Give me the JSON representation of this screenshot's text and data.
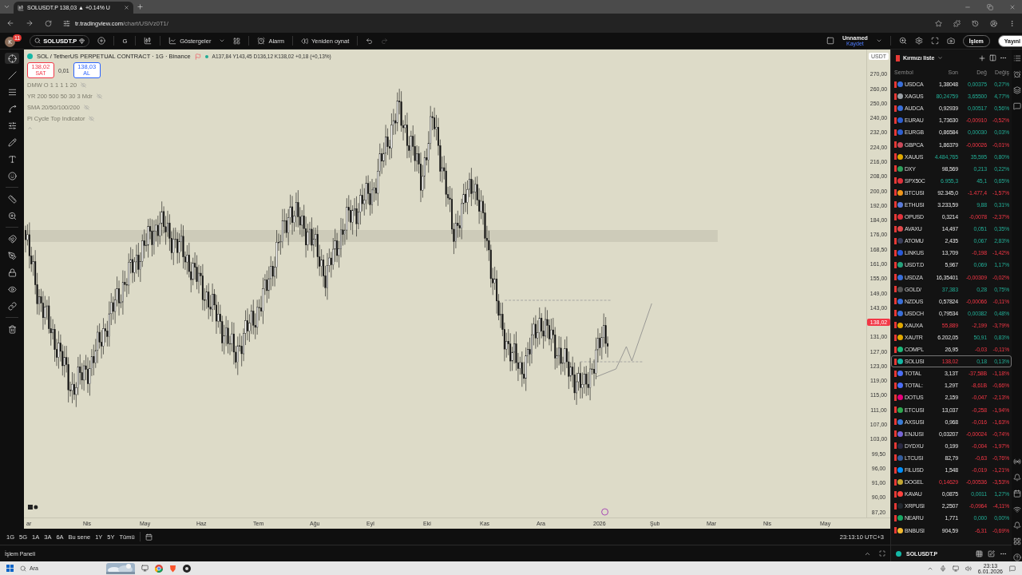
{
  "browser": {
    "tab": {
      "title": "SOLUSDT.P 138,03 ▲ +0.14% U"
    },
    "url": {
      "host": "tr.tradingview.com",
      "path": "/chart/USiVz0T1/"
    }
  },
  "toolbar": {
    "avatar": "K",
    "notifications": "11",
    "symbol": "SOLUSDT.P",
    "interval": "G",
    "indicators": "Göstergeler",
    "alarm": "Alarm",
    "replay": "Yeniden oynat",
    "layout": {
      "name": "Unnamed",
      "save": "Kaydet"
    },
    "trade": "İşlem",
    "publish": "Yayınl"
  },
  "chart": {
    "legend": {
      "title": "SOL / TetherUS PERPETUAL CONTRACT · 1G · Binance",
      "ohlc": "A137,84 Y143,45 D136,12 K138,02 +0,18 (+0,13%)"
    },
    "sell": {
      "price": "138,02",
      "label": "SAT"
    },
    "spread": "0,01",
    "buy": {
      "price": "138,03",
      "label": "AL"
    },
    "indicators": [
      {
        "name": "DMW O 1 1 1 1 20",
        "visible": false
      },
      {
        "name": "YR 200 500 50 30 3 Mdr",
        "visible": false
      },
      {
        "name": "SMA 20/50/100/200",
        "visible": false
      },
      {
        "name": "Pi Cycle Top Indicator",
        "visible": false
      }
    ],
    "currency": "USDT",
    "price_axis": [
      {
        "label": "270,00",
        "kind": "tick"
      },
      {
        "label": "260,00",
        "kind": "tick"
      },
      {
        "label": "250,00",
        "kind": "tick"
      },
      {
        "label": "240,00",
        "kind": "tick"
      },
      {
        "label": "232,00",
        "kind": "tick"
      },
      {
        "label": "224,00",
        "kind": "tick"
      },
      {
        "label": "216,00",
        "kind": "tick"
      },
      {
        "label": "208,00",
        "kind": "tick"
      },
      {
        "label": "200,00",
        "kind": "tick"
      },
      {
        "label": "192,00",
        "kind": "tick"
      },
      {
        "label": "184,00",
        "kind": "tick"
      },
      {
        "label": "176,00",
        "kind": "tick"
      },
      {
        "label": "168,50",
        "kind": "tick"
      },
      {
        "label": "161,00",
        "kind": "tick"
      },
      {
        "label": "155,00",
        "kind": "tick"
      },
      {
        "label": "149,00",
        "kind": "tick"
      },
      {
        "label": "143,00",
        "kind": "tick"
      },
      {
        "label": "138,02",
        "kind": "current"
      },
      {
        "label": "131,00",
        "kind": "tick"
      },
      {
        "label": "127,00",
        "kind": "tick"
      },
      {
        "label": "123,00",
        "kind": "tick"
      },
      {
        "label": "119,00",
        "kind": "tick"
      },
      {
        "label": "115,00",
        "kind": "tick"
      },
      {
        "label": "111,00",
        "kind": "tick"
      },
      {
        "label": "107,00",
        "kind": "tick"
      },
      {
        "label": "103,00",
        "kind": "tick"
      },
      {
        "label": "99,50",
        "kind": "tick"
      },
      {
        "label": "96,00",
        "kind": "tick"
      },
      {
        "label": "91,00",
        "kind": "tick"
      },
      {
        "label": "90,00",
        "kind": "tick"
      },
      {
        "label": "87,20",
        "kind": "tick"
      }
    ],
    "time_axis": [
      "ar",
      "Nis",
      "May",
      "Haz",
      "Tem",
      "Ağu",
      "Eyl",
      "Eki",
      "Kas",
      "Ara",
      "2026",
      "Şub",
      "Mar",
      "Nis",
      "May"
    ]
  },
  "range_bar": {
    "ranges": [
      "1G",
      "5G",
      "1A",
      "3A",
      "6A",
      "Bu sene",
      "1Y",
      "5Y",
      "Tümü"
    ],
    "clock": "23:13:10 UTC+3"
  },
  "bottom_panel": {
    "title": "İşlem Paneli"
  },
  "watchlist": {
    "title": "Kırmızı liste",
    "columns": [
      "Sembol",
      "Son",
      "Değ",
      "Değiş"
    ],
    "rows": [
      {
        "symbol": "USDCA",
        "last": "1,38048",
        "change": "0,00375",
        "change_pct": "0,27%",
        "change_up": true,
        "last_up": false,
        "last_down": false,
        "color": "#3a6fd8",
        "selected": false
      },
      {
        "symbol": "XAGUS",
        "last": "80,24759",
        "change": "3,65500",
        "change_pct": "4,77%",
        "change_up": true,
        "last_up": true,
        "last_down": false,
        "color": "#9aa0a6",
        "selected": false
      },
      {
        "symbol": "AUDCA",
        "last": "0,92939",
        "change": "0,00517",
        "change_pct": "0,56%",
        "change_up": true,
        "last_up": false,
        "last_down": false,
        "color": "#3a6fd8",
        "selected": false
      },
      {
        "symbol": "EURAU",
        "last": "1,73630",
        "change": "-0,00910",
        "change_pct": "-0,52%",
        "change_up": false,
        "last_up": false,
        "last_down": false,
        "color": "#2f5fd0",
        "selected": false
      },
      {
        "symbol": "EURGB",
        "last": "0,86584",
        "change": "0,00030",
        "change_pct": "0,03%",
        "change_up": true,
        "last_up": false,
        "last_down": false,
        "color": "#2f5fd0",
        "selected": false
      },
      {
        "symbol": "GBPCA",
        "last": "1,86379",
        "change": "-0,00026",
        "change_pct": "-0,01%",
        "change_up": false,
        "last_up": false,
        "last_down": false,
        "color": "#c94a5a",
        "selected": false
      },
      {
        "symbol": "XAUUS",
        "last": "4.484,765",
        "change": "35,595",
        "change_pct": "0,80%",
        "change_up": true,
        "last_up": true,
        "last_down": false,
        "color": "#e0a800",
        "selected": false
      },
      {
        "symbol": "DXY",
        "last": "98,569",
        "change": "0,213",
        "change_pct": "0,22%",
        "change_up": true,
        "last_up": false,
        "last_down": false,
        "color": "#2e9e5b",
        "selected": false
      },
      {
        "symbol": "SPX50C",
        "last": "6.955,3",
        "change": "45,1",
        "change_pct": "0,65%",
        "change_up": true,
        "last_up": true,
        "last_down": false,
        "color": "#e0323c",
        "selected": false
      },
      {
        "symbol": "BTCUSI",
        "last": "92.345,0",
        "change": "-1.477,4",
        "change_pct": "-1,57%",
        "change_up": false,
        "last_up": false,
        "last_down": false,
        "color": "#f0961a",
        "selected": false
      },
      {
        "symbol": "ETHUSI",
        "last": "3.233,59",
        "change": "9,88",
        "change_pct": "0,31%",
        "change_up": true,
        "last_up": false,
        "last_down": false,
        "color": "#5b7bd8",
        "selected": false
      },
      {
        "symbol": "OPUSD",
        "last": "0,3214",
        "change": "-0,0078",
        "change_pct": "-2,37%",
        "change_up": false,
        "last_up": false,
        "last_down": false,
        "color": "#e0323c",
        "selected": false
      },
      {
        "symbol": "AVAXU",
        "last": "14,497",
        "change": "0,051",
        "change_pct": "0,35%",
        "change_up": true,
        "last_up": false,
        "last_down": false,
        "color": "#e0484a",
        "selected": false
      },
      {
        "symbol": "ATOMU",
        "last": "2,435",
        "change": "0,067",
        "change_pct": "2,83%",
        "change_up": true,
        "last_up": false,
        "last_down": false,
        "color": "#3b3f5c",
        "selected": false
      },
      {
        "symbol": "LINKUS",
        "last": "13,709",
        "change": "-0,198",
        "change_pct": "-1,42%",
        "change_up": false,
        "last_up": false,
        "last_down": false,
        "color": "#2a5ada",
        "selected": false
      },
      {
        "symbol": "USDT.D",
        "last": "5,967",
        "change": "0,069",
        "change_pct": "1,17%",
        "change_up": true,
        "last_up": false,
        "last_down": false,
        "color": "#26a17b",
        "selected": false
      },
      {
        "symbol": "USDZA",
        "last": "16,35401",
        "change": "-0,00309",
        "change_pct": "-0,02%",
        "change_up": false,
        "last_up": false,
        "last_down": false,
        "color": "#3a6fd8",
        "selected": false
      },
      {
        "symbol": "GOLD/",
        "last": "37,383",
        "change": "0,28",
        "change_pct": "0,75%",
        "change_up": true,
        "last_up": true,
        "last_down": false,
        "color": "#555555",
        "selected": false
      },
      {
        "symbol": "NZDUS",
        "last": "0,57824",
        "change": "-0,00066",
        "change_pct": "-0,11%",
        "change_up": false,
        "last_up": false,
        "last_down": false,
        "color": "#3a6fd8",
        "selected": false
      },
      {
        "symbol": "USDCH",
        "last": "0,79534",
        "change": "0,00382",
        "change_pct": "0,48%",
        "change_up": true,
        "last_up": false,
        "last_down": false,
        "color": "#3a6fd8",
        "selected": false
      },
      {
        "symbol": "XAUXA",
        "last": "55,889",
        "change": "-2,199",
        "change_pct": "-3,79%",
        "change_up": false,
        "last_up": false,
        "last_down": true,
        "color": "#e0a800",
        "selected": false
      },
      {
        "symbol": "XAUTR",
        "last": "6.202,05",
        "change": "50,91",
        "change_pct": "0,83%",
        "change_up": true,
        "last_up": false,
        "last_down": false,
        "color": "#e0a800",
        "selected": false
      },
      {
        "symbol": "COMPL",
        "last": "26,95",
        "change": "-0,03",
        "change_pct": "-0,11%",
        "change_up": false,
        "last_up": false,
        "last_down": false,
        "color": "#1db87a",
        "selected": false
      },
      {
        "symbol": "SOLUSI",
        "last": "138,02",
        "change": "0,18",
        "change_pct": "0,13%",
        "change_up": true,
        "last_up": false,
        "last_down": true,
        "color": "#14b8a6",
        "selected": true
      },
      {
        "symbol": "TOTAL",
        "last": "3,13T",
        "change": "-37,58B",
        "change_pct": "-1,18%",
        "change_up": false,
        "last_up": false,
        "last_down": false,
        "color": "#4c6ef5",
        "selected": false
      },
      {
        "symbol": "TOTAL:",
        "last": "1,29T",
        "change": "-8,61B",
        "change_pct": "-0,66%",
        "change_up": false,
        "last_up": false,
        "last_down": false,
        "color": "#4c6ef5",
        "selected": false
      },
      {
        "symbol": "DOTUS",
        "last": "2,159",
        "change": "-0,047",
        "change_pct": "-2,13%",
        "change_up": false,
        "last_up": false,
        "last_down": false,
        "color": "#e6007a",
        "selected": false
      },
      {
        "symbol": "ETCUSI",
        "last": "13,037",
        "change": "-0,258",
        "change_pct": "-1,94%",
        "change_up": false,
        "last_up": false,
        "last_down": false,
        "color": "#2fa84f",
        "selected": false
      },
      {
        "symbol": "AXSUSI",
        "last": "0,968",
        "change": "-0,016",
        "change_pct": "-1,63%",
        "change_up": false,
        "last_up": false,
        "last_down": false,
        "color": "#3a7bd5",
        "selected": false
      },
      {
        "symbol": "ENJUSI",
        "last": "0,03207",
        "change": "-0,00024",
        "change_pct": "-0,74%",
        "change_up": false,
        "last_up": false,
        "last_down": false,
        "color": "#7866d5",
        "selected": false
      },
      {
        "symbol": "DYDXU",
        "last": "0,199",
        "change": "-0,004",
        "change_pct": "-1,97%",
        "change_up": false,
        "last_up": false,
        "last_down": false,
        "color": "#2b2b45",
        "selected": false
      },
      {
        "symbol": "LTCUSI",
        "last": "82,79",
        "change": "-0,63",
        "change_pct": "-0,76%",
        "change_up": false,
        "last_up": false,
        "last_down": false,
        "color": "#345d9d",
        "selected": false
      },
      {
        "symbol": "FILUSD",
        "last": "1,548",
        "change": "-0,019",
        "change_pct": "-1,21%",
        "change_up": false,
        "last_up": false,
        "last_down": false,
        "color": "#0090ff",
        "selected": false
      },
      {
        "symbol": "DOGEL",
        "last": "0,14629",
        "change": "-0,00536",
        "change_pct": "-3,53%",
        "change_up": false,
        "last_up": false,
        "last_down": true,
        "color": "#c2a633",
        "selected": false
      },
      {
        "symbol": "KAVAU",
        "last": "0,0875",
        "change": "0,0011",
        "change_pct": "1,27%",
        "change_up": true,
        "last_up": false,
        "last_down": false,
        "color": "#ff433e",
        "selected": false
      },
      {
        "symbol": "XRPUSI",
        "last": "2,2507",
        "change": "-0,0964",
        "change_pct": "-4,11%",
        "change_up": false,
        "last_up": false,
        "last_down": false,
        "color": "#23292f",
        "selected": false
      },
      {
        "symbol": "NEARU",
        "last": "1,771",
        "change": "0,000",
        "change_pct": "0,00%",
        "change_up": true,
        "last_up": false,
        "last_down": false,
        "color": "#19a663",
        "selected": false
      },
      {
        "symbol": "BNBUSI",
        "last": "904,59",
        "change": "-6,31",
        "change_pct": "-0,69%",
        "change_up": false,
        "last_up": false,
        "last_down": false,
        "color": "#f3ba2f",
        "selected": false
      }
    ],
    "footer": "SOLUSDT.P"
  },
  "taskbar": {
    "search": "Ara",
    "time": "23:13",
    "date": "6.01.2026"
  }
}
